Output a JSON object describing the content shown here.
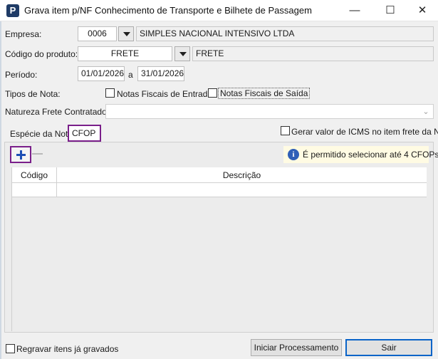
{
  "window": {
    "title": "Grava item p/NF Conhecimento de Transporte e Bilhete de Passagem",
    "icon_letter": "P",
    "controls": {
      "minimize": "—",
      "maximize": "☐",
      "close": "✕"
    }
  },
  "form": {
    "empresa": {
      "label": "Empresa:",
      "code": "0006",
      "name": "SIMPLES NACIONAL INTENSIVO LTDA"
    },
    "produto": {
      "label": "Código do produto:",
      "code": "FRETE",
      "name": "FRETE"
    },
    "periodo": {
      "label": "Período:",
      "start": "01/01/2026",
      "separator": "a",
      "end": "31/01/2026"
    },
    "tipos_nota": {
      "label": "Tipos de Nota:",
      "entrada": {
        "label": "Notas Fiscais de Entrada",
        "checked": false
      },
      "saida": {
        "label": "Notas Fiscais de Saída",
        "checked": false
      }
    },
    "natureza": {
      "label": "Natureza Frete Contratado:",
      "value": ""
    }
  },
  "tabs": [
    {
      "label": "Espécie da Nota",
      "active": false
    },
    {
      "label": "CFOP",
      "active": true
    }
  ],
  "gerar_icms": {
    "label": "Gerar valor de ICMS no item frete da NF",
    "checked": false
  },
  "toolbar": {
    "add_icon": "plus-icon",
    "remove_icon": "minus-icon"
  },
  "info": {
    "icon": "info-icon",
    "icon_glyph": "i",
    "text": "É permitido selecionar até 4 CFOPs"
  },
  "grid": {
    "columns": [
      "Código",
      "Descrição"
    ],
    "rows": [
      {
        "codigo": "",
        "descricao": ""
      }
    ]
  },
  "footer": {
    "regravar": {
      "label": "Regravar itens já gravados",
      "checked": false
    },
    "iniciar_label": "Iniciar Processamento",
    "sair_label": "Sair"
  },
  "colors": {
    "accent_highlight": "#7a1f8a",
    "plus_blue": "#1d4fb5",
    "info_bg": "#fffbe3",
    "default_button_border": "#0a64c8"
  }
}
